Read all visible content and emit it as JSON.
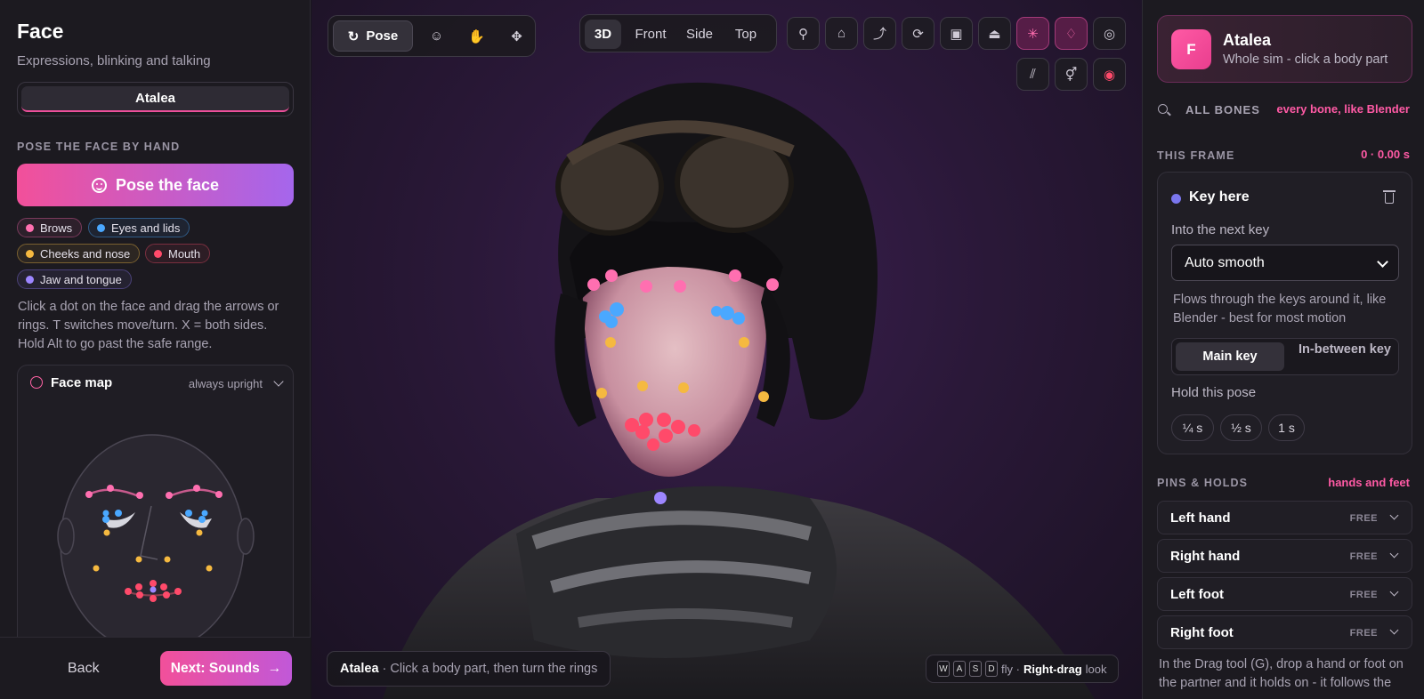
{
  "left_panel": {
    "title": "Face",
    "subtitle": "Expressions, blinking and talking",
    "character_tab": "Atalea",
    "section_label": "POSE THE FACE BY HAND",
    "pose_button": "Pose the face",
    "chips": [
      {
        "label": "Brows",
        "color": "#ff6fb0"
      },
      {
        "label": "Eyes and lids",
        "color": "#4aa8ff"
      },
      {
        "label": "Cheeks and nose",
        "color": "#f5b940"
      },
      {
        "label": "Mouth",
        "color": "#ff4a6a"
      },
      {
        "label": "Jaw and tongue",
        "color": "#9d86ff"
      }
    ],
    "help_text": "Click a dot on the face and drag the arrows or rings. T switches move/turn. X = both sides. Hold Alt to go past the safe range.",
    "face_map": {
      "title": "Face map",
      "mode": "always upright"
    },
    "back_button": "Back",
    "next_button": "Next: Sounds"
  },
  "toolbar": {
    "pose_label": "Pose",
    "pose_tools": [
      "face-icon",
      "hand-icon",
      "move-icon"
    ],
    "views": [
      "3D",
      "Front",
      "Side",
      "Top"
    ],
    "active_view": "3D",
    "icon_tools": [
      "bulb-icon",
      "lock-icon",
      "path-icon",
      "rotate-icon",
      "image-icon",
      "hanger-icon",
      "sparkle-icon",
      "drop-icon",
      "eye-icon"
    ],
    "icon_tools_row2": [
      "hair-icon",
      "gender-icon",
      "record-icon"
    ]
  },
  "viewport": {
    "status_name": "Atalea",
    "status_text": "· Click a body part, then turn the rings",
    "keys": [
      "W",
      "A",
      "S",
      "D"
    ],
    "fly_label": "fly ·",
    "look_key": "Right-drag",
    "look_label": "look"
  },
  "right_panel": {
    "character": {
      "initial": "F",
      "name": "Atalea",
      "subtitle": "Whole sim - click a body part"
    },
    "all_bones": "ALL BONES",
    "all_bones_hint": "every bone, like Blender",
    "this_frame": "THIS FRAME",
    "frame_time": "0 · 0.00 s",
    "key": {
      "title": "Key here",
      "into_label": "Into the next key",
      "interp_value": "Auto smooth",
      "description": "Flows through the keys around it, like Blender - best for most motion",
      "main_key": "Main key",
      "inbetween_key": "In-between key",
      "hold_label": "Hold this pose",
      "hold_options": [
        "¼ s",
        "½ s",
        "1 s"
      ]
    },
    "pins_label": "PINS & HOLDS",
    "pins_hint": "hands and feet",
    "pins": [
      {
        "name": "Left hand",
        "state": "FREE"
      },
      {
        "name": "Right hand",
        "state": "FREE"
      },
      {
        "name": "Left foot",
        "state": "FREE"
      },
      {
        "name": "Right foot",
        "state": "FREE"
      }
    ],
    "footer_text": "In the Drag tool (G), drop a hand or foot on the partner and it holds on - it follows the"
  },
  "colors": {
    "accent_pink": "#f2509a",
    "accent_purple": "#a566ec",
    "brows": "#ff6fb0",
    "eyes": "#4aa8ff",
    "cheeks": "#f5b940",
    "mouth": "#ff4a6a",
    "jaw": "#9d86ff"
  }
}
